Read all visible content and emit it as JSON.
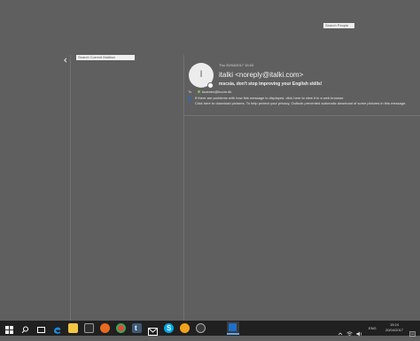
{
  "search_people": {
    "placeholder": "Search People"
  },
  "collapse_icon": "chevron-left-icon",
  "search_mailbox": {
    "placeholder": "Search Current Mailbox"
  },
  "message": {
    "avatar_initial": "I",
    "date": "Thu 20/04/2017 15:03",
    "sender": "italki <noreply@italki.com>",
    "subject": "mscsia, don't stop improving your English skills!",
    "to_label": "To",
    "to_recipient": "kuanrex@kuom.dk",
    "info_line_1": "If there are problems with how this message is displayed, click here to view it in a web browser.",
    "info_line_2": "Click here to download pictures. To help protect your privacy, Outlook prevented automatic download of some pictures in this message."
  },
  "taskbar": {
    "apps": [
      "windows-start-icon",
      "search-icon",
      "task-view-icon",
      "edge-icon",
      "file-explorer-icon",
      "store-icon",
      "firefox-icon",
      "chrome-icon",
      "tumblr-icon",
      "mail-icon",
      "skype-icon",
      "onenote-icon",
      "clock-app-icon",
      "outlook-icon"
    ],
    "language": "ENG",
    "time": "15:24",
    "date": "20/04/2017"
  },
  "colors": {
    "background": "#5f5f5f",
    "taskbar": "#202020",
    "accent": "#1e6fc9",
    "online_status": "#7cc043"
  }
}
